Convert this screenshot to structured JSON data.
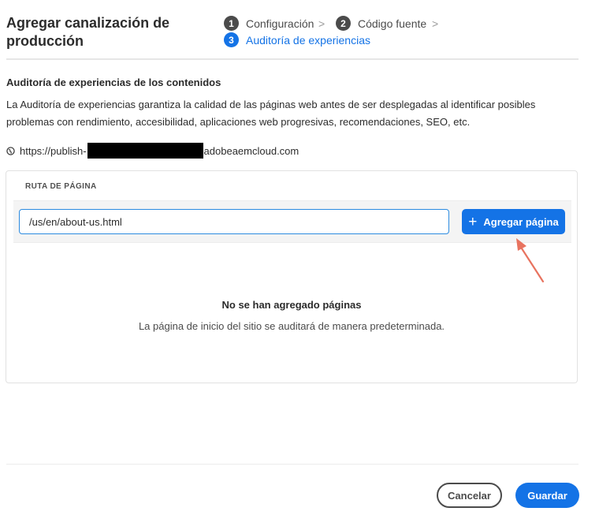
{
  "dialog": {
    "title": "Agregar canalización de producción"
  },
  "stepper": {
    "steps": [
      {
        "number": "1",
        "label": "Configuración",
        "state": "done"
      },
      {
        "number": "2",
        "label": "Código fuente",
        "state": "done"
      },
      {
        "number": "3",
        "label": "Auditoría de experiencias",
        "state": "current"
      }
    ],
    "separator": ">"
  },
  "section": {
    "heading": "Auditoría de experiencias de los contenidos",
    "description": "La Auditoría de experiencias garantiza la calidad de las páginas web antes de ser desplegadas al identificar posibles problemas con rendimiento, accesibilidad, aplicaciones web progresivas, recomendaciones, SEO, etc."
  },
  "site_url": {
    "icon": "globe-icon",
    "prefix": "https://publish-",
    "suffix": "adobeaemcloud.com"
  },
  "page_path": {
    "column_label": "RUTA DE PÁGINA",
    "input_value": "/us/en/about-us.html",
    "add_button_icon": "plus-icon",
    "add_button_label": "Agregar página"
  },
  "empty_state": {
    "title": "No se han agregado páginas",
    "description": "La página de inicio del sitio se auditará de manera predeterminada."
  },
  "footer": {
    "cancel_label": "Cancelar",
    "save_label": "Guardar"
  },
  "colors": {
    "accent": "#1473e6",
    "annotation": "#e8735f",
    "step_done": "#4b4b4b"
  }
}
